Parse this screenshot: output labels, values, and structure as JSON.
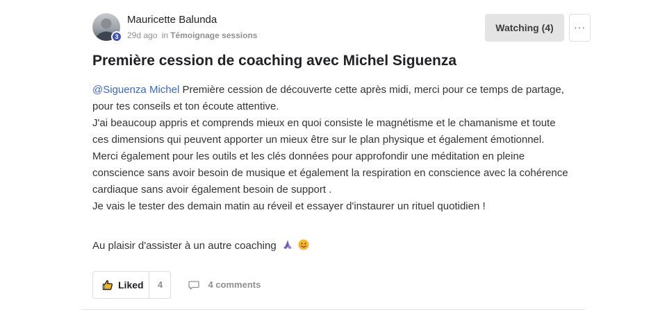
{
  "post": {
    "author": {
      "name": "Mauricette Balunda",
      "level": "3",
      "time_ago": "29d ago",
      "in_word": "in",
      "category": "Témoignage sessions"
    },
    "watch_button": "Watching (4)",
    "more_button": "···",
    "title": "Première cession de coaching avec Michel Siguenza",
    "body": {
      "mention": "@Siguenza Michel",
      "line1_rest": " Première cession de découverte cette après midi, merci pour ce temps de partage, pour tes conseils et ton écoute attentive.",
      "paragraph2": "J'ai beaucoup appris et comprends mieux en quoi consiste le magnétisme et le chamanisme et toute ces dimensions qui peuvent apporter un mieux être sur le plan physique et également émotionnel.",
      "paragraph3": "Merci également pour les outils et les clés données pour approfondir une méditation en pleine conscience sans avoir besoin de musique et également la respiration en conscience avec la cohérence cardiaque sans avoir également besoin de support .",
      "paragraph4": "Je vais le tester des demain matin au réveil et essayer d'instaurer un rituel quotidien !",
      "closing": "Au plaisir d'assister à un autre coaching"
    },
    "actions": {
      "like_label": "Liked",
      "like_count": "4",
      "comments_label": "4 comments"
    },
    "colors": {
      "mention": "#3c66c4",
      "badge": "#3f51b5",
      "watch_bg": "#e4e4e4"
    },
    "icons": [
      "thumbs-up-icon",
      "comment-icon",
      "folded-hands-emoji",
      "smiling-face-emoji",
      "more-icon"
    ]
  }
}
